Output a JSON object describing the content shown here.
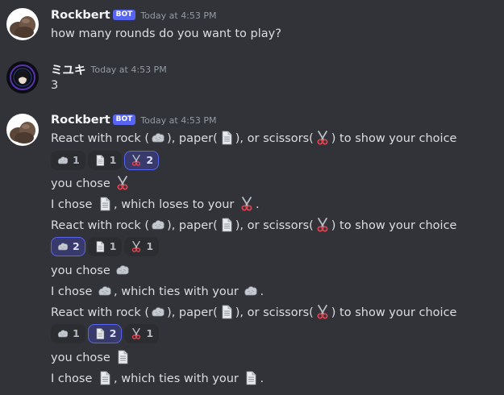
{
  "messages": [
    {
      "author": "Rockbert",
      "bot_badge": "BOT",
      "time": "Today at 4:53 PM",
      "text": "how many rounds do you want to play?"
    },
    {
      "author": "ミユキ",
      "time": "Today at 4:53 PM",
      "text": "3"
    },
    {
      "author": "Rockbert",
      "bot_badge": "BOT",
      "time": "Today at 4:53 PM",
      "prompt": {
        "p1": "React with rock (",
        "p2": "), paper(",
        "p3": "), or scissors(",
        "p4": ") to show your choice"
      },
      "reactions_1": [
        {
          "icon": "rock-icon",
          "count": "1",
          "selected": false
        },
        {
          "icon": "page-icon",
          "count": "1",
          "selected": false
        },
        {
          "icon": "scissors-icon",
          "count": "2",
          "selected": true
        }
      ],
      "round1": {
        "you_chose": "you chose",
        "i_chose": "I chose",
        "result": ", which loses to your",
        "end": "."
      },
      "reactions_2": [
        {
          "icon": "rock-icon",
          "count": "2",
          "selected": true
        },
        {
          "icon": "page-icon",
          "count": "1",
          "selected": false
        },
        {
          "icon": "scissors-icon",
          "count": "1",
          "selected": false
        }
      ],
      "round2": {
        "you_chose": "you chose",
        "i_chose": "I chose",
        "result": ", which ties with your",
        "end": "."
      },
      "reactions_3": [
        {
          "icon": "rock-icon",
          "count": "1",
          "selected": false
        },
        {
          "icon": "page-icon",
          "count": "2",
          "selected": true
        },
        {
          "icon": "scissors-icon",
          "count": "1",
          "selected": false
        }
      ],
      "round3": {
        "you_chose": "you chose",
        "i_chose": "I chose",
        "result": ", which ties with your",
        "end": "."
      }
    }
  ],
  "colors": {
    "background": "#313338",
    "text": "#dbdee1",
    "username": "#f2f3f5",
    "timestamp": "#949ba4",
    "bot_badge": "#5865f2",
    "reaction_bg": "#2b2d31",
    "reaction_selected_bg": "#373a6a",
    "reaction_selected_border": "#5865f2"
  }
}
